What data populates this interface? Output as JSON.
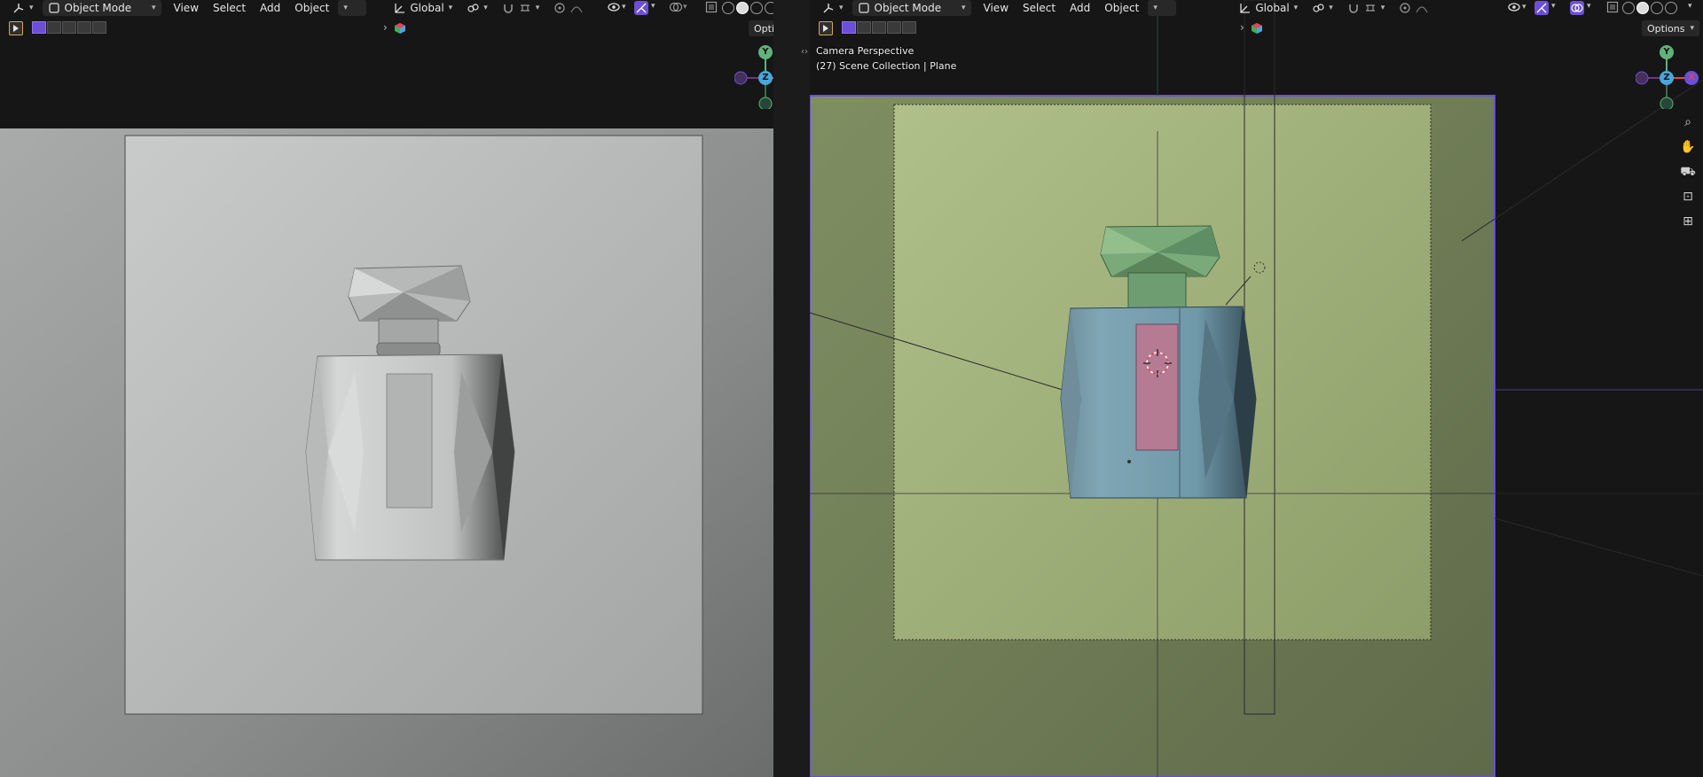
{
  "left_viewport": {
    "header": {
      "mode_label": "Object Mode",
      "menus": [
        "View",
        "Select",
        "Add",
        "Object"
      ],
      "orientation_label": "Global"
    },
    "options_label": "Options",
    "gizmo": {
      "y": "Y",
      "z": "Z",
      "x": "X"
    }
  },
  "right_viewport": {
    "header": {
      "mode_label": "Object Mode",
      "menus": [
        "View",
        "Select",
        "Add",
        "Object"
      ],
      "orientation_label": "Global"
    },
    "options_label": "Options",
    "gizmo": {
      "y": "Y",
      "z": "Z",
      "x": "X"
    },
    "overlay": {
      "view_name": "Camera Perspective",
      "collection_info": "(27) Scene Collection | Plane"
    }
  },
  "icons": {
    "editor_type": "cube-axes-icon",
    "object_mode": "object-mode-icon",
    "transform_pivot": "pivot-icon",
    "snap": "magnet-icon",
    "proportional": "proportional-icon",
    "visibility": "eye-icon",
    "gizmo_toggle": "gizmo-icon",
    "overlays": "overlays-icon",
    "xray": "xray-icon",
    "zoom": "zoom-icon",
    "pan": "hand-icon",
    "camera": "camera-icon",
    "lock": "lock-icon",
    "frame": "frame-icon"
  },
  "colors": {
    "axis_x": "#e0445c",
    "axis_y": "#5fb37b",
    "axis_z": "#4aa6db",
    "selection_accent": "#6b4fd6",
    "camera_frame": "#b4c587"
  }
}
